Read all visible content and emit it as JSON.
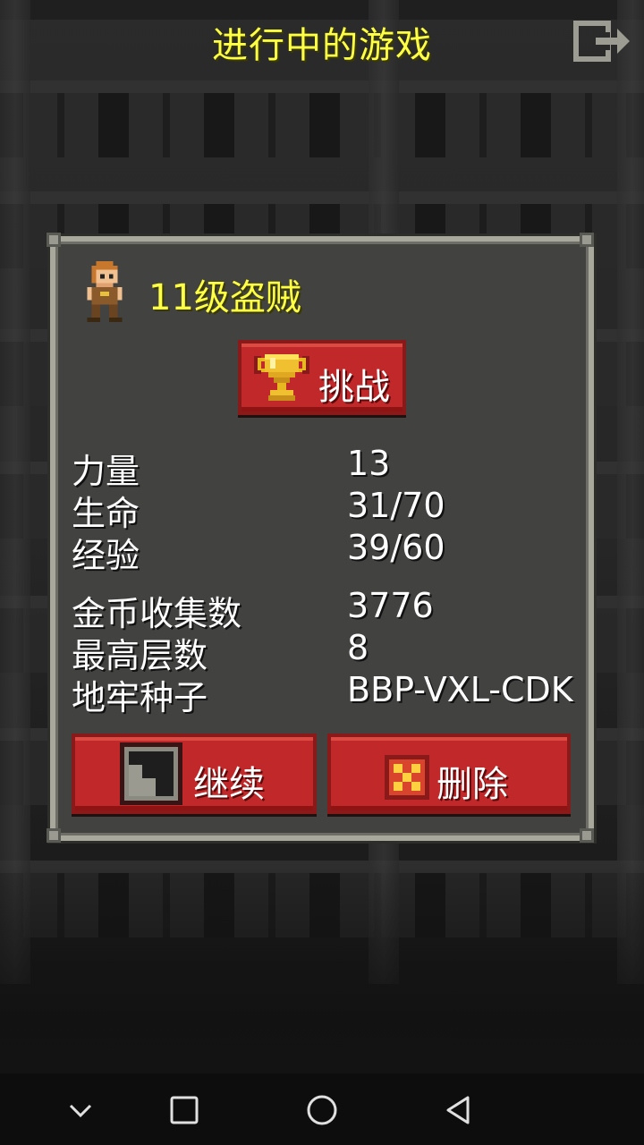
{
  "header": {
    "title": "进行中的游戏",
    "exit_icon": "exit-door-icon"
  },
  "hero": {
    "avatar_icon": "rogue-hero-sprite",
    "title": "11级盗贼"
  },
  "challenge": {
    "icon": "trophy-icon",
    "label": "挑战"
  },
  "stats": [
    {
      "label": "力量",
      "value": "13"
    },
    {
      "label": "生命",
      "value": "31/70"
    },
    {
      "label": "经验",
      "value": "39/60"
    },
    {
      "label": "金币收集数",
      "value": "3776"
    },
    {
      "label": "最高层数",
      "value": "8"
    },
    {
      "label": "地牢种子",
      "value": "BBP-VXL-CDK"
    }
  ],
  "actions": {
    "continue": {
      "icon": "stairs-icon",
      "label": "继续"
    },
    "delete": {
      "icon": "close-x-icon",
      "label": "删除"
    }
  },
  "navbar": {
    "items": [
      "chevron-down-icon",
      "recents-square-icon",
      "home-circle-icon",
      "back-triangle-icon"
    ]
  },
  "colors": {
    "title_yellow": "#ffff44",
    "panel_bg": "#424241",
    "panel_border": "#a8a89c",
    "button_red": "#c0282a",
    "text_white": "#ffffff"
  }
}
